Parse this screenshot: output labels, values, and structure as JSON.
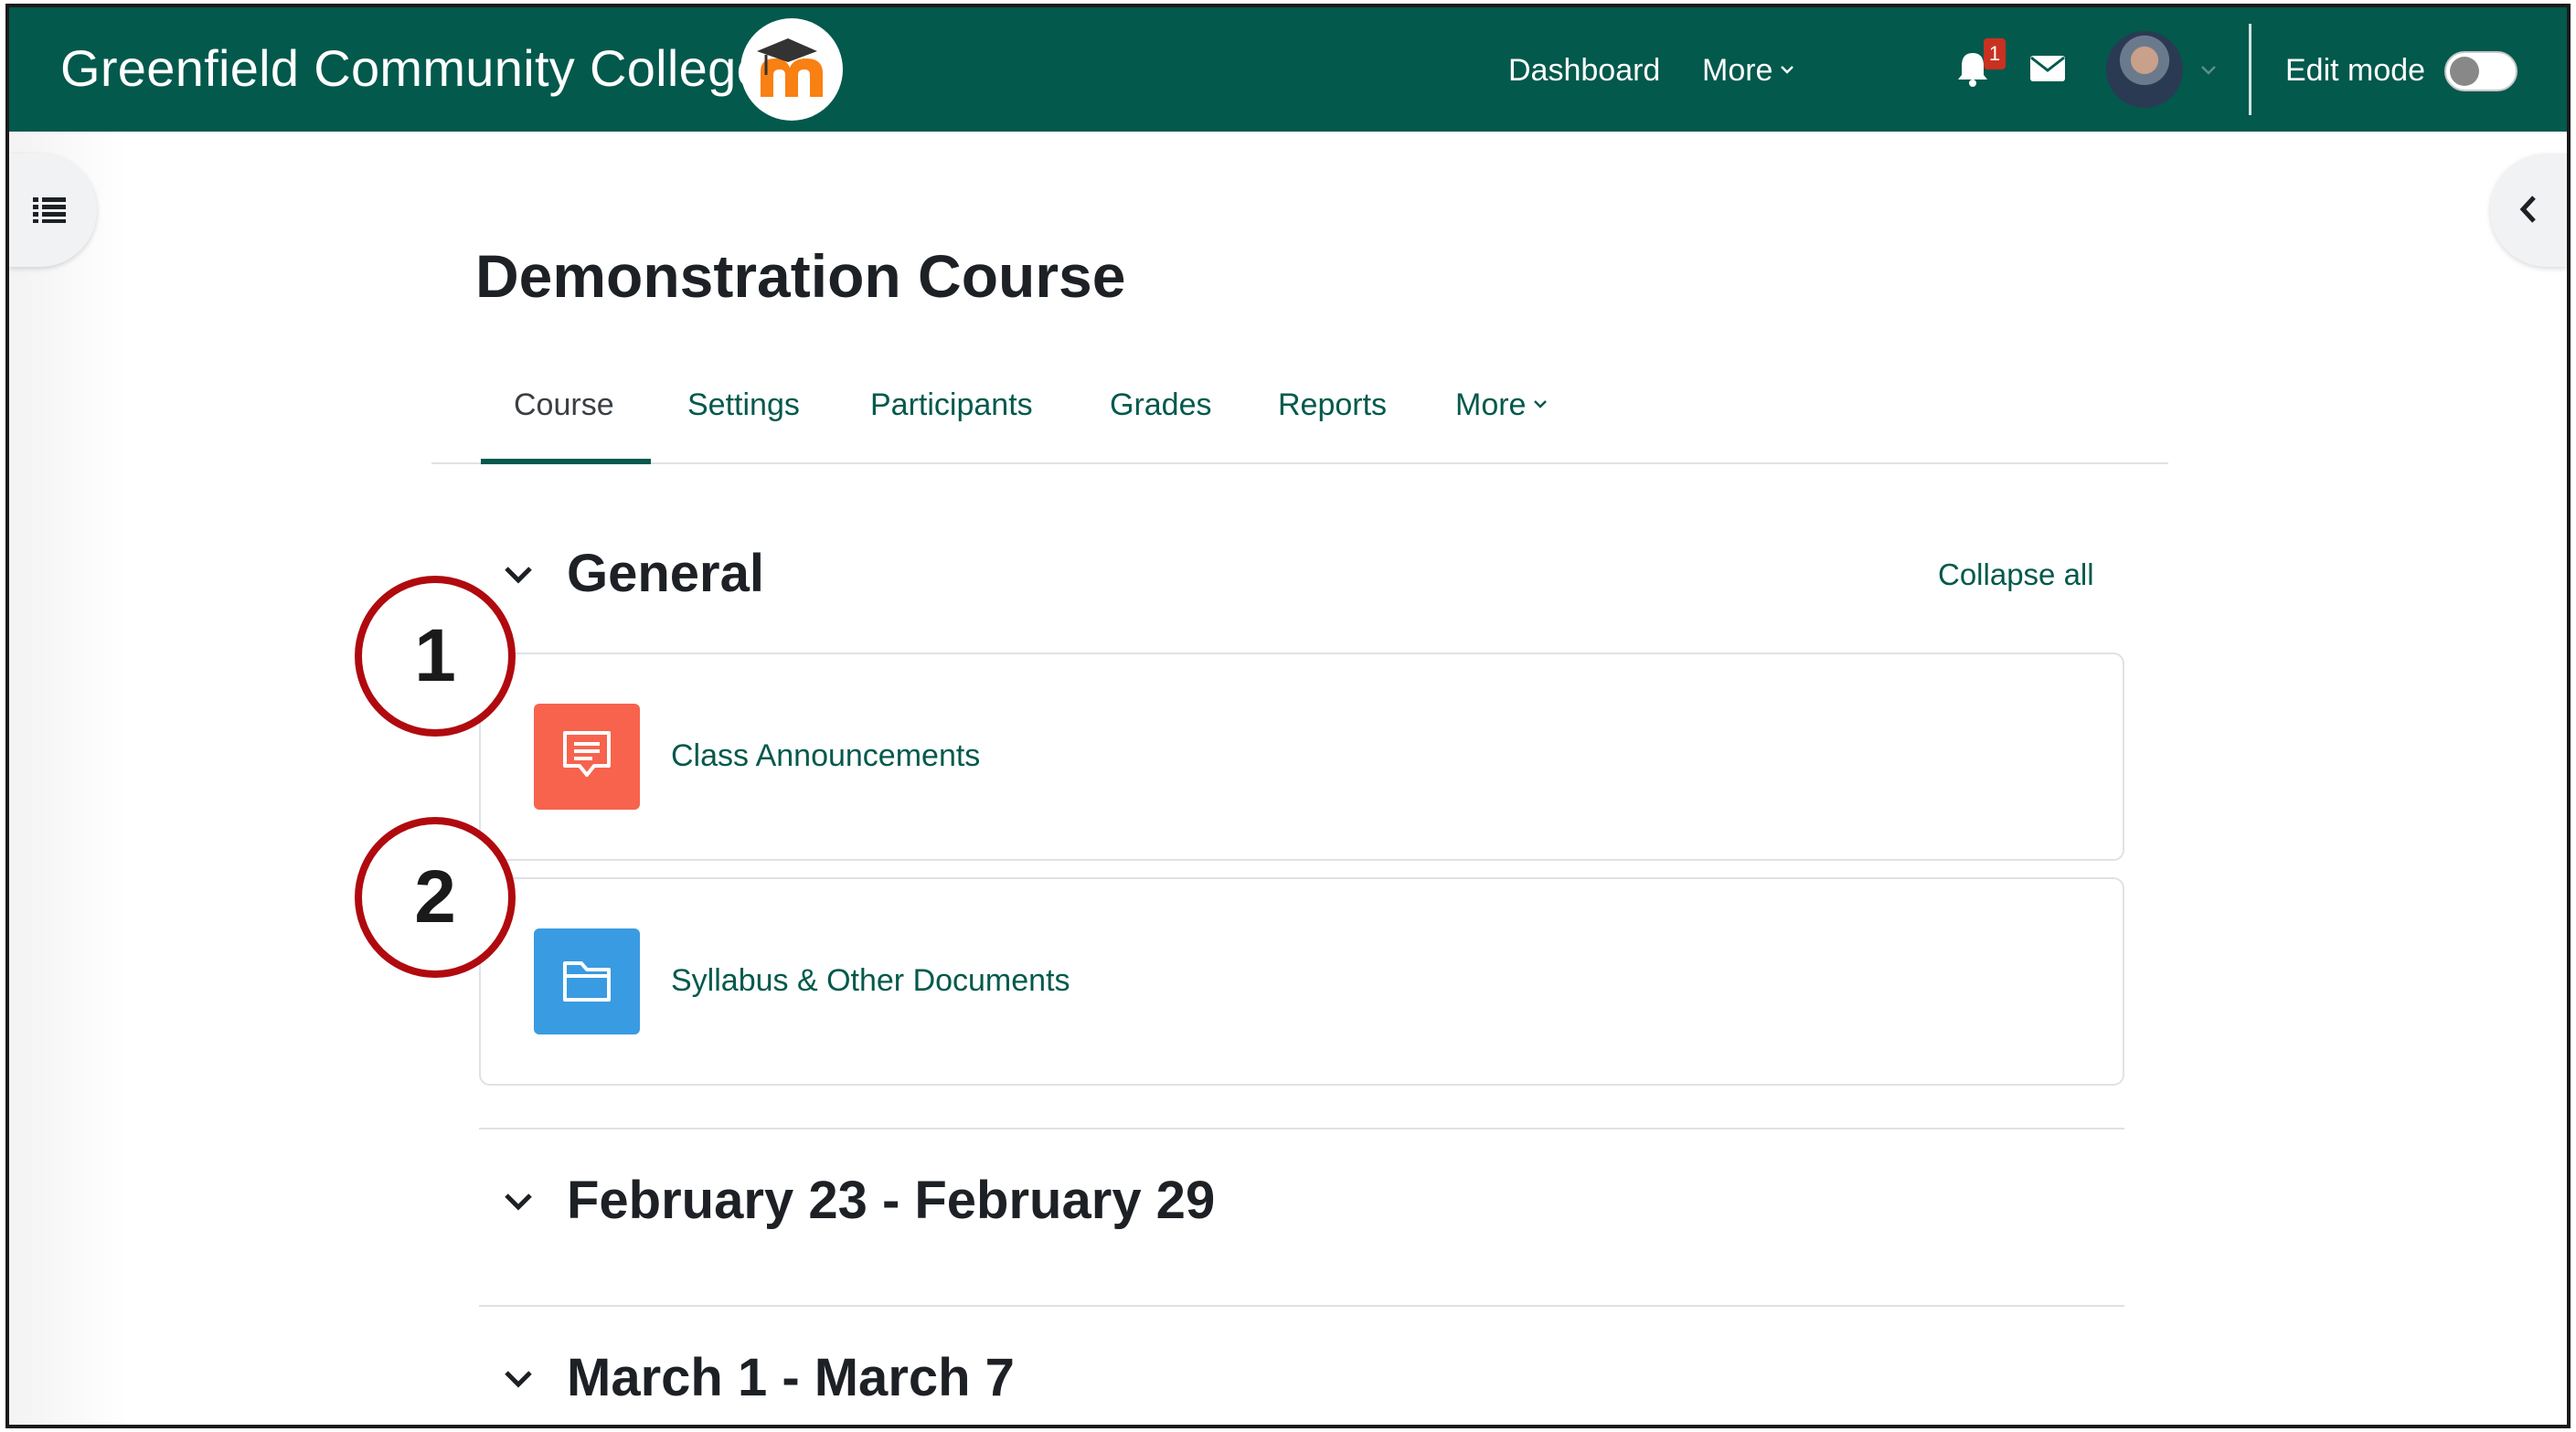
{
  "navbar": {
    "site_name": "Greenfield Community College",
    "links": {
      "dashboard": "Dashboard",
      "more": "More"
    },
    "notification_count": "1",
    "edit_mode_label": "Edit mode",
    "brand_color": "#02594c"
  },
  "course": {
    "title": "Demonstration Course",
    "tabs": [
      {
        "label": "Course",
        "active": true
      },
      {
        "label": "Settings"
      },
      {
        "label": "Participants"
      },
      {
        "label": "Grades"
      },
      {
        "label": "Reports"
      },
      {
        "label": "More"
      }
    ],
    "collapse_all": "Collapse all",
    "sections": [
      {
        "title": "General",
        "activities": [
          {
            "label": "Class Announcements",
            "icon": "forum-icon",
            "icon_color": "#f7634d"
          },
          {
            "label": "Syllabus & Other Documents",
            "icon": "folder-icon",
            "icon_color": "#399be2"
          }
        ]
      },
      {
        "title": "February 23 - February 29"
      },
      {
        "title": "March 1 - March 7"
      }
    ]
  },
  "callouts": [
    "1",
    "2"
  ]
}
